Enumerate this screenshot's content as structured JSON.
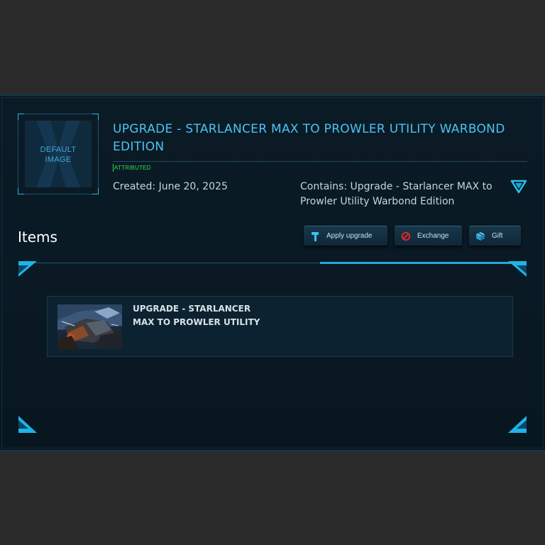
{
  "pledge": {
    "thumbnail": {
      "text_line1": "DEFAULT",
      "text_line2": "IMAGE"
    },
    "title": "UPGRADE - STARLANCER MAX TO PROWLER UTILITY WARBOND EDITION",
    "badge": "ATTRIBUTED",
    "created": "Created: June 20, 2025",
    "contains": "Contains: Upgrade - Starlancer MAX to Prowler Utility Warbond Edition"
  },
  "items_section": {
    "heading": "Items",
    "actions": {
      "apply_upgrade": "Apply upgrade",
      "exchange": "Exchange",
      "gift": "Gift"
    },
    "items": [
      {
        "name": "UPGRADE - STARLANCER MAX TO PROWLER UTILITY"
      }
    ]
  },
  "colors": {
    "accent": "#27b6e6",
    "title": "#4cc3f2",
    "badge": "#2ee04a",
    "panel_bg": "#0a1923",
    "outer_bg": "#2a2a2b"
  },
  "icons": {
    "expand": "chevron-down-triangle-icon",
    "apply": "hammer-icon",
    "exchange": "no-entry-icon",
    "gift": "gift-box-icon"
  }
}
